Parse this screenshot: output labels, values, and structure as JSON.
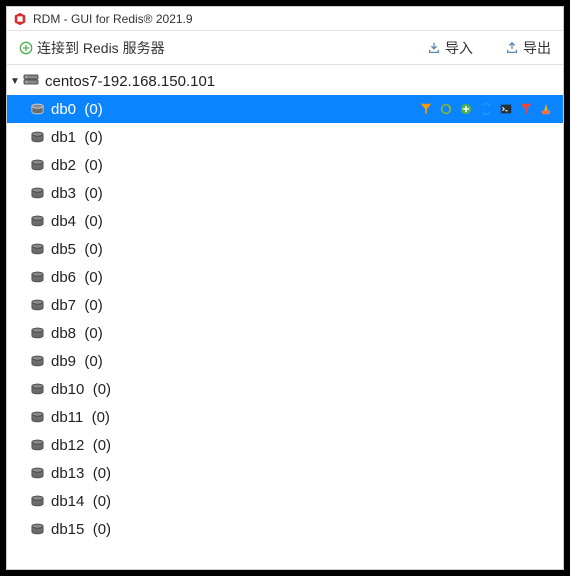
{
  "window": {
    "title": "RDM - GUI for Redis® 2021.9"
  },
  "toolbar": {
    "connect_label": "连接到 Redis 服务器",
    "import_label": "导入",
    "export_label": "导出"
  },
  "connection": {
    "name": "centos7-192.168.150.101",
    "expanded": true
  },
  "databases": [
    {
      "name": "db0",
      "count": "(0)",
      "selected": true
    },
    {
      "name": "db1",
      "count": "(0)",
      "selected": false
    },
    {
      "name": "db2",
      "count": "(0)",
      "selected": false
    },
    {
      "name": "db3",
      "count": "(0)",
      "selected": false
    },
    {
      "name": "db4",
      "count": "(0)",
      "selected": false
    },
    {
      "name": "db5",
      "count": "(0)",
      "selected": false
    },
    {
      "name": "db6",
      "count": "(0)",
      "selected": false
    },
    {
      "name": "db7",
      "count": "(0)",
      "selected": false
    },
    {
      "name": "db8",
      "count": "(0)",
      "selected": false
    },
    {
      "name": "db9",
      "count": "(0)",
      "selected": false
    },
    {
      "name": "db10",
      "count": "(0)",
      "selected": false
    },
    {
      "name": "db11",
      "count": "(0)",
      "selected": false
    },
    {
      "name": "db12",
      "count": "(0)",
      "selected": false
    },
    {
      "name": "db13",
      "count": "(0)",
      "selected": false
    },
    {
      "name": "db14",
      "count": "(0)",
      "selected": false
    },
    {
      "name": "db15",
      "count": "(0)",
      "selected": false
    }
  ],
  "row_actions": {
    "filter": "filter",
    "reload": "reload",
    "add": "add",
    "refresh": "refresh",
    "console": "console",
    "flush": "flush",
    "delete": "delete"
  }
}
